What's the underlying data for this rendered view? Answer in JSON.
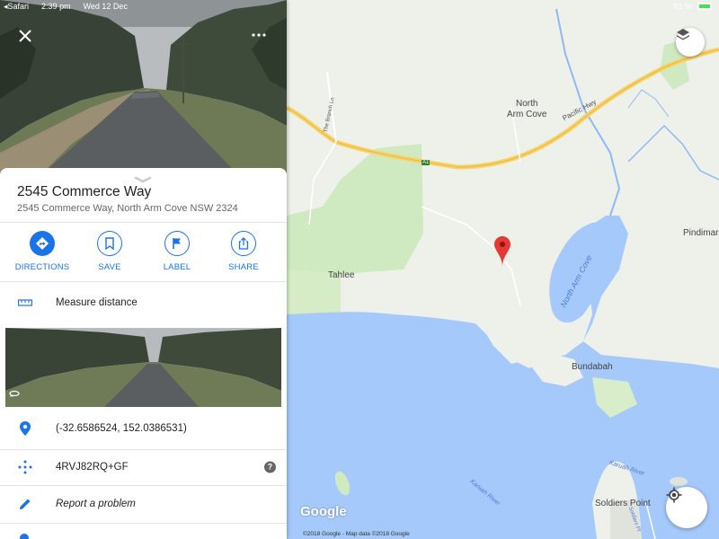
{
  "status_bar": {
    "app": "Safari",
    "time": "2:39 pm",
    "date": "Wed 12 Dec",
    "battery": "81 %"
  },
  "place": {
    "title": "2545 Commerce Way",
    "address": "2545 Commerce Way, North Arm Cove NSW 2324"
  },
  "actions": [
    {
      "label": "DIRECTIONS",
      "icon": "directions-icon"
    },
    {
      "label": "SAVE",
      "icon": "bookmark-icon"
    },
    {
      "label": "LABEL",
      "icon": "flag-icon"
    },
    {
      "label": "SHARE",
      "icon": "share-icon"
    }
  ],
  "rows": {
    "measure": "Measure distance",
    "coordinates": "(-32.6586524, 152.0386531)",
    "plus_code": "4RVJ82RQ+GF",
    "report": "Report a problem",
    "help": "?"
  },
  "map": {
    "places": {
      "north_arm_cove": "North\nArm Cove",
      "pindimar": "Pindimar",
      "tahlee": "Tahlee",
      "bundabah": "Bundabah",
      "soldiers_point": "Soldiers Point"
    },
    "roads": {
      "pacific_hwy": "Pacific Hwy",
      "the_branch_ln": "The Branch Ln",
      "a1": "A1"
    },
    "water": {
      "north_arm_cove": "North Arm Cove",
      "karuah_river_1": "Karuah River",
      "karuah_river_2": "Karuah River",
      "soldiers_pt": "Soldiers Pt"
    },
    "logo": "Google",
    "copyright": "©2018 Google - Map data ©2018 Google"
  },
  "colors": {
    "accent": "#1a73e8",
    "water": "#a4c8fd",
    "park": "#c6e8b4",
    "land": "#f2efe9",
    "highway": "#f7d36a",
    "marker": "#e53935"
  }
}
